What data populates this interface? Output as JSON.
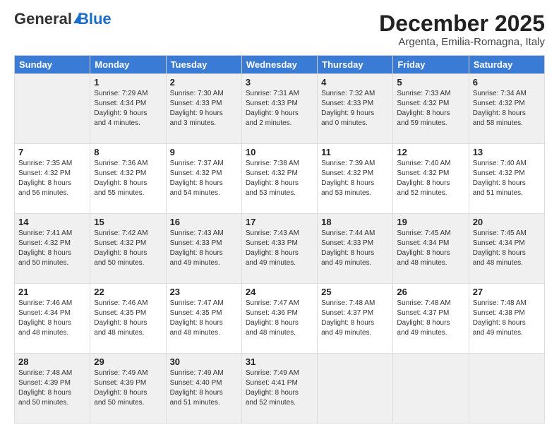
{
  "header": {
    "logo_general": "General",
    "logo_blue": "Blue",
    "month": "December 2025",
    "location": "Argenta, Emilia-Romagna, Italy"
  },
  "days": [
    "Sunday",
    "Monday",
    "Tuesday",
    "Wednesday",
    "Thursday",
    "Friday",
    "Saturday"
  ],
  "weeks": [
    [
      {
        "num": "",
        "sunrise": "",
        "sunset": "",
        "daylight": "",
        "empty": true
      },
      {
        "num": "1",
        "sunrise": "Sunrise: 7:29 AM",
        "sunset": "Sunset: 4:34 PM",
        "daylight": "Daylight: 9 hours and 4 minutes."
      },
      {
        "num": "2",
        "sunrise": "Sunrise: 7:30 AM",
        "sunset": "Sunset: 4:33 PM",
        "daylight": "Daylight: 9 hours and 3 minutes."
      },
      {
        "num": "3",
        "sunrise": "Sunrise: 7:31 AM",
        "sunset": "Sunset: 4:33 PM",
        "daylight": "Daylight: 9 hours and 2 minutes."
      },
      {
        "num": "4",
        "sunrise": "Sunrise: 7:32 AM",
        "sunset": "Sunset: 4:33 PM",
        "daylight": "Daylight: 9 hours and 0 minutes."
      },
      {
        "num": "5",
        "sunrise": "Sunrise: 7:33 AM",
        "sunset": "Sunset: 4:32 PM",
        "daylight": "Daylight: 8 hours and 59 minutes."
      },
      {
        "num": "6",
        "sunrise": "Sunrise: 7:34 AM",
        "sunset": "Sunset: 4:32 PM",
        "daylight": "Daylight: 8 hours and 58 minutes."
      }
    ],
    [
      {
        "num": "7",
        "sunrise": "Sunrise: 7:35 AM",
        "sunset": "Sunset: 4:32 PM",
        "daylight": "Daylight: 8 hours and 56 minutes."
      },
      {
        "num": "8",
        "sunrise": "Sunrise: 7:36 AM",
        "sunset": "Sunset: 4:32 PM",
        "daylight": "Daylight: 8 hours and 55 minutes."
      },
      {
        "num": "9",
        "sunrise": "Sunrise: 7:37 AM",
        "sunset": "Sunset: 4:32 PM",
        "daylight": "Daylight: 8 hours and 54 minutes."
      },
      {
        "num": "10",
        "sunrise": "Sunrise: 7:38 AM",
        "sunset": "Sunset: 4:32 PM",
        "daylight": "Daylight: 8 hours and 53 minutes."
      },
      {
        "num": "11",
        "sunrise": "Sunrise: 7:39 AM",
        "sunset": "Sunset: 4:32 PM",
        "daylight": "Daylight: 8 hours and 53 minutes."
      },
      {
        "num": "12",
        "sunrise": "Sunrise: 7:40 AM",
        "sunset": "Sunset: 4:32 PM",
        "daylight": "Daylight: 8 hours and 52 minutes."
      },
      {
        "num": "13",
        "sunrise": "Sunrise: 7:40 AM",
        "sunset": "Sunset: 4:32 PM",
        "daylight": "Daylight: 8 hours and 51 minutes."
      }
    ],
    [
      {
        "num": "14",
        "sunrise": "Sunrise: 7:41 AM",
        "sunset": "Sunset: 4:32 PM",
        "daylight": "Daylight: 8 hours and 50 minutes."
      },
      {
        "num": "15",
        "sunrise": "Sunrise: 7:42 AM",
        "sunset": "Sunset: 4:32 PM",
        "daylight": "Daylight: 8 hours and 50 minutes."
      },
      {
        "num": "16",
        "sunrise": "Sunrise: 7:43 AM",
        "sunset": "Sunset: 4:33 PM",
        "daylight": "Daylight: 8 hours and 49 minutes."
      },
      {
        "num": "17",
        "sunrise": "Sunrise: 7:43 AM",
        "sunset": "Sunset: 4:33 PM",
        "daylight": "Daylight: 8 hours and 49 minutes."
      },
      {
        "num": "18",
        "sunrise": "Sunrise: 7:44 AM",
        "sunset": "Sunset: 4:33 PM",
        "daylight": "Daylight: 8 hours and 49 minutes."
      },
      {
        "num": "19",
        "sunrise": "Sunrise: 7:45 AM",
        "sunset": "Sunset: 4:34 PM",
        "daylight": "Daylight: 8 hours and 48 minutes."
      },
      {
        "num": "20",
        "sunrise": "Sunrise: 7:45 AM",
        "sunset": "Sunset: 4:34 PM",
        "daylight": "Daylight: 8 hours and 48 minutes."
      }
    ],
    [
      {
        "num": "21",
        "sunrise": "Sunrise: 7:46 AM",
        "sunset": "Sunset: 4:34 PM",
        "daylight": "Daylight: 8 hours and 48 minutes."
      },
      {
        "num": "22",
        "sunrise": "Sunrise: 7:46 AM",
        "sunset": "Sunset: 4:35 PM",
        "daylight": "Daylight: 8 hours and 48 minutes."
      },
      {
        "num": "23",
        "sunrise": "Sunrise: 7:47 AM",
        "sunset": "Sunset: 4:35 PM",
        "daylight": "Daylight: 8 hours and 48 minutes."
      },
      {
        "num": "24",
        "sunrise": "Sunrise: 7:47 AM",
        "sunset": "Sunset: 4:36 PM",
        "daylight": "Daylight: 8 hours and 48 minutes."
      },
      {
        "num": "25",
        "sunrise": "Sunrise: 7:48 AM",
        "sunset": "Sunset: 4:37 PM",
        "daylight": "Daylight: 8 hours and 49 minutes."
      },
      {
        "num": "26",
        "sunrise": "Sunrise: 7:48 AM",
        "sunset": "Sunset: 4:37 PM",
        "daylight": "Daylight: 8 hours and 49 minutes."
      },
      {
        "num": "27",
        "sunrise": "Sunrise: 7:48 AM",
        "sunset": "Sunset: 4:38 PM",
        "daylight": "Daylight: 8 hours and 49 minutes."
      }
    ],
    [
      {
        "num": "28",
        "sunrise": "Sunrise: 7:48 AM",
        "sunset": "Sunset: 4:39 PM",
        "daylight": "Daylight: 8 hours and 50 minutes."
      },
      {
        "num": "29",
        "sunrise": "Sunrise: 7:49 AM",
        "sunset": "Sunset: 4:39 PM",
        "daylight": "Daylight: 8 hours and 50 minutes."
      },
      {
        "num": "30",
        "sunrise": "Sunrise: 7:49 AM",
        "sunset": "Sunset: 4:40 PM",
        "daylight": "Daylight: 8 hours and 51 minutes."
      },
      {
        "num": "31",
        "sunrise": "Sunrise: 7:49 AM",
        "sunset": "Sunset: 4:41 PM",
        "daylight": "Daylight: 8 hours and 52 minutes."
      },
      {
        "num": "",
        "sunrise": "",
        "sunset": "",
        "daylight": "",
        "empty": true
      },
      {
        "num": "",
        "sunrise": "",
        "sunset": "",
        "daylight": "",
        "empty": true
      },
      {
        "num": "",
        "sunrise": "",
        "sunset": "",
        "daylight": "",
        "empty": true
      }
    ]
  ]
}
